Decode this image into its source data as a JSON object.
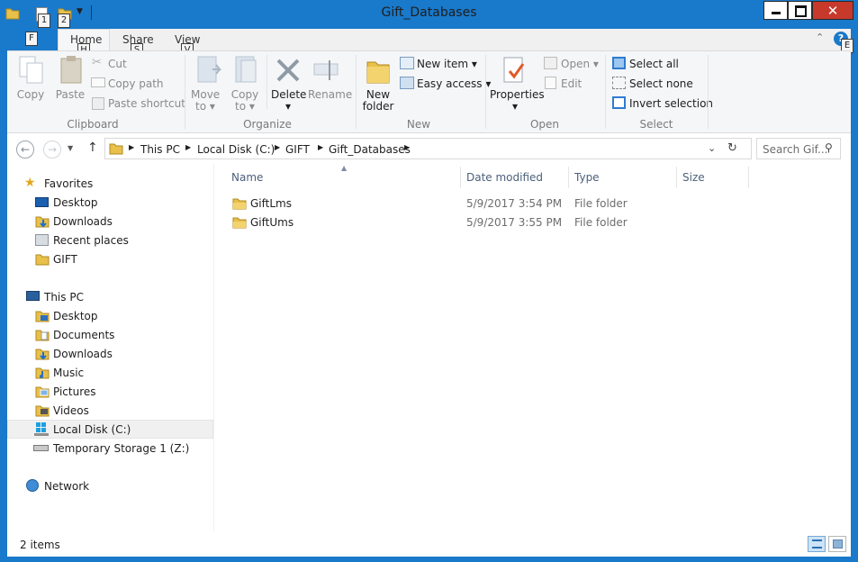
{
  "window": {
    "title": "Gift_Databases"
  },
  "qat_keytips": [
    "1",
    "2"
  ],
  "ribbon_tabs": [
    {
      "label": "Home",
      "keytip": "H"
    },
    {
      "label": "Share",
      "keytip": "S"
    },
    {
      "label": "View",
      "keytip": "V"
    }
  ],
  "file_tab": {
    "keytip": "F"
  },
  "help_keytip": "E",
  "clipboard": {
    "copy": "Copy",
    "paste": "Paste",
    "cut": "Cut",
    "copy_path": "Copy path",
    "paste_shortcut": "Paste shortcut",
    "group": "Clipboard"
  },
  "organize": {
    "move_to_1": "Move",
    "move_to_2": "to",
    "copy_to_1": "Copy",
    "copy_to_2": "to",
    "delete": "Delete",
    "rename": "Rename",
    "group": "Organize"
  },
  "new": {
    "new_folder_1": "New",
    "new_folder_2": "folder",
    "new_item": "New item",
    "easy_access": "Easy access",
    "group": "New"
  },
  "open": {
    "properties": "Properties",
    "open": "Open",
    "edit": "Edit",
    "group": "Open"
  },
  "select": {
    "select_all": "Select all",
    "select_none": "Select none",
    "invert": "Invert selection",
    "group": "Select"
  },
  "address": {
    "crumbs": [
      "This PC",
      "Local Disk (C:)",
      "GIFT",
      "Gift_Databases"
    ]
  },
  "search": {
    "placeholder": "Search Gif..."
  },
  "navpane": {
    "favorites": "Favorites",
    "fav_items": [
      "Desktop",
      "Downloads",
      "Recent places",
      "GIFT"
    ],
    "thispc": "This PC",
    "pc_items": [
      "Desktop",
      "Documents",
      "Downloads",
      "Music",
      "Pictures",
      "Videos",
      "Local Disk (C:)",
      "Temporary Storage 1 (Z:)"
    ],
    "network": "Network"
  },
  "columns": [
    "Name",
    "Date modified",
    "Type",
    "Size"
  ],
  "files": [
    {
      "name": "GiftLms",
      "date": "5/9/2017 3:54 PM",
      "type": "File folder"
    },
    {
      "name": "GiftUms",
      "date": "5/9/2017 3:55 PM",
      "type": "File folder"
    }
  ],
  "status": {
    "item_count": "2 items"
  },
  "colors": {
    "frame": "#1979ca",
    "close": "#c7392b",
    "folder": "#e8c04a"
  }
}
